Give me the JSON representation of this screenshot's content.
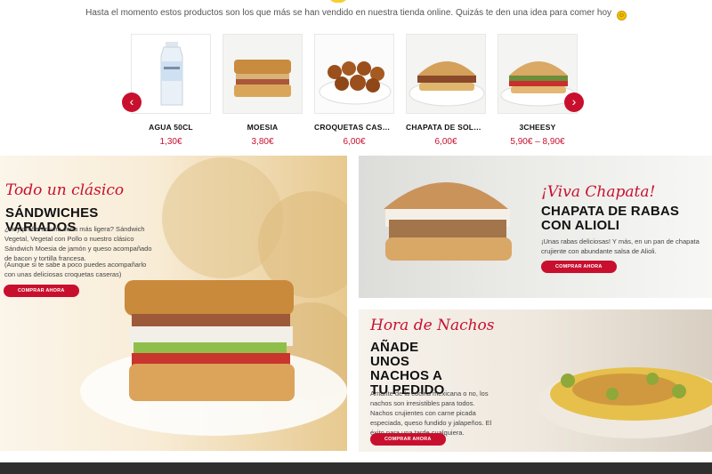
{
  "intro": {
    "text": "Hasta el momento estos productos son los que más se han vendido en nuestra tienda online. Quizás te den una idea para comer hoy",
    "emoji": "☺"
  },
  "carousel": {
    "prev_icon": "‹",
    "next_icon": "›",
    "products": [
      {
        "name": "AGUA 50CL",
        "price": "1,30€"
      },
      {
        "name": "MOESIA",
        "price": "3,80€"
      },
      {
        "name": "CROQUETAS CASERAS",
        "price": "6,00€"
      },
      {
        "name": "CHAPATA DE SOLOMILLO C...",
        "price": "6,00€"
      },
      {
        "name": "3CHEESY",
        "price": "5,90€ – 8,90€"
      }
    ]
  },
  "promos": {
    "sandwiches": {
      "script": "Todo un clásico",
      "title": "SÁNDWICHES VARIADOS",
      "text1": "¿Hoy prefieres una cena más ligera? Sándwich Vegetal, Vegetal con Pollo o nuestro clásico Sándwich Moesia de jamón y queso acompañado de bacon y tortilla francesa.",
      "text2": "(Aunque si te sabe a poco puedes acompañarlo con unas deliciosas croquetas caseras)",
      "button": "COMPRAR AHORA"
    },
    "chapata": {
      "script": "¡Viva Chapata!",
      "title": "CHAPATA DE RABAS CON ALIOLI",
      "text": "¡Unas rabas deliciosas! Y más, en un pan de chapata crujiente con abundante salsa de Alioli.",
      "button": "COMPRAR AHORA"
    },
    "nachos": {
      "script": "Hora de Nachos",
      "title": "AÑADE UNOS NACHOS A TU PEDIDO",
      "text": "Amante de la cocina mexicana o no, los nachos son irresistibles para todos. Nachos crujientes con carne picada especiada, queso fundido y jalapeños. El éxito para una tarde cualquiera.",
      "button": "COMPRAR AHORA"
    }
  },
  "colors": {
    "accent": "#c8102e",
    "footer": "#2e2e2e"
  }
}
